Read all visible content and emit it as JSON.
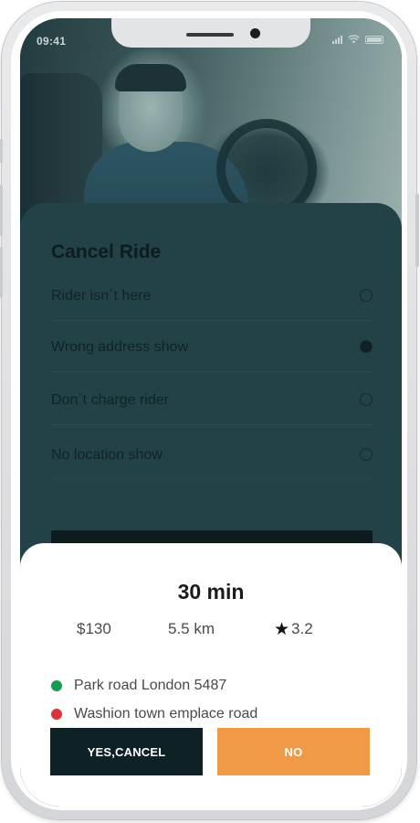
{
  "status_bar": {
    "time": "09:41"
  },
  "cancel_panel": {
    "title": "Cancel Ride",
    "reasons": [
      {
        "label": "Rider isn`t here",
        "selected": false
      },
      {
        "label": "Wrong address show",
        "selected": true
      },
      {
        "label": "Don`t charge rider",
        "selected": false
      },
      {
        "label": "No location show",
        "selected": false
      }
    ]
  },
  "sheet": {
    "eta": "30 min",
    "price": "$130",
    "distance": "5.5 km",
    "rating": "3.2",
    "pickup": "Park road London 5487",
    "dropoff": "Washion town emplace road",
    "yes_label": "YES,CANCEL",
    "no_label": "NO"
  },
  "colors": {
    "accent_orange": "#f09a48",
    "dark_teal": "#0e2226",
    "pickup_dot": "#1a9b55",
    "dropoff_dot": "#d9343a"
  },
  "icons": [
    "star-icon",
    "signal-icon",
    "wifi-icon",
    "battery-icon"
  ]
}
